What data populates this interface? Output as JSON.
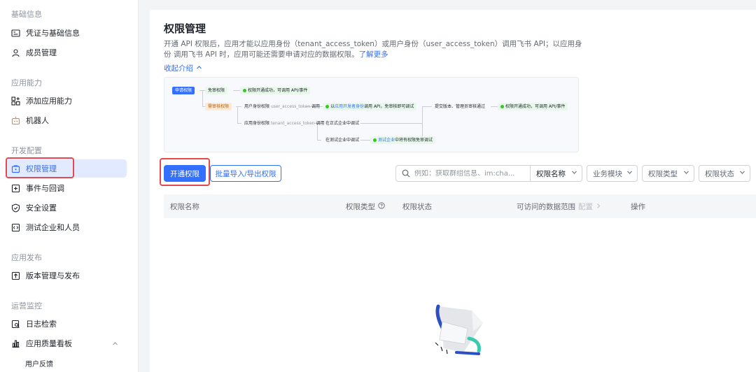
{
  "sidebar": {
    "groups": [
      {
        "title": "基础信息"
      },
      {
        "title": "应用能力"
      },
      {
        "title": "开发配置"
      },
      {
        "title": "应用发布"
      },
      {
        "title": "运营监控"
      }
    ],
    "items": [
      {
        "label": "凭证与基础信息"
      },
      {
        "label": "成员管理"
      },
      {
        "label": "添加应用能力"
      },
      {
        "label": "机器人"
      },
      {
        "label": "权限管理"
      },
      {
        "label": "事件与回调"
      },
      {
        "label": "安全设置"
      },
      {
        "label": "测试企业和人员"
      },
      {
        "label": "版本管理与发布"
      },
      {
        "label": "日志检索"
      },
      {
        "label": "应用质量看板"
      },
      {
        "label": "用户反馈"
      }
    ]
  },
  "header": {
    "title": "权限管理",
    "desc_line1": "开通 API 权限后，应用才能以应用身份（tenant_access_token）或用户身份（user_access_token）调用飞书 API；以应用身份",
    "desc_line2": "调用飞书 API 时，应用可能还需要申请对应的数据权限。",
    "learn_more": "了解更多",
    "collapse": "收起介绍"
  },
  "flow": {
    "start": "申请权限",
    "free": "免审权限",
    "free_result": "权限开通成功，可调用 API/事件",
    "review": "需审核权限",
    "user_identity": "用户身份权限",
    "user_token": "user_access_token",
    "call": "调用",
    "dev_prefix": "以",
    "dev_highlight": "应用开发者身份",
    "dev_suffix": "调用 API，免审核即可调试",
    "submit": "提交版本、管理员审核通过",
    "final_result": "权限开通成功，可调用 API/事件",
    "app_identity": "应用身份权限",
    "tenant_token": "tenant_access_token",
    "prod_debug": "在正式企业中调试",
    "test_debug": "在测试企业中调试",
    "test_result_hl": "测试企业",
    "test_result": "中将有权限免审调试"
  },
  "toolbar": {
    "open_button": "开通权限",
    "batch_button": "批量导入/导出权限",
    "search_placeholder": "例如：获取群组信息、im:cha...",
    "filter_name": "权限名称",
    "filter_module": "业务模块",
    "filter_type": "权限类型",
    "filter_status": "权限状态"
  },
  "table": {
    "columns": [
      {
        "label": "权限名称"
      },
      {
        "label": "权限类型"
      },
      {
        "label": "权限状态"
      },
      {
        "label": "可访问的数据范围",
        "extra": "配置"
      },
      {
        "label": "操作"
      }
    ]
  },
  "colors": {
    "accent": "#3370ff",
    "highlight_box": "#e5484d",
    "active_bg": "#e1eaff"
  }
}
